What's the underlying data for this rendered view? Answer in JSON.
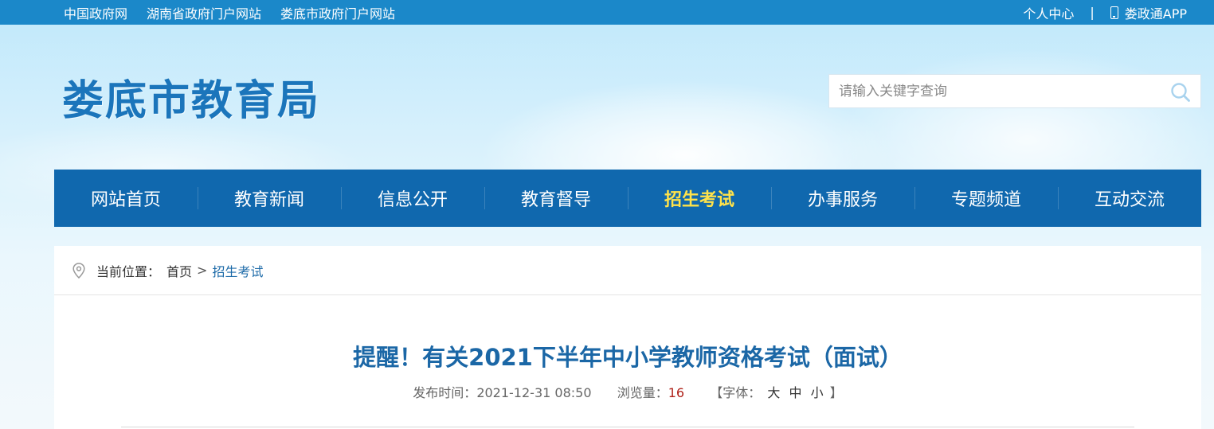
{
  "topbar": {
    "links": [
      "中国政府网",
      "湖南省政府门户网站",
      "娄底市政府门户网站"
    ],
    "personal_center": "个人中心",
    "separator": "|",
    "app": "娄政通APP"
  },
  "site": {
    "logo_text": "娄底市教育局"
  },
  "search": {
    "placeholder": "请输入关键字查询"
  },
  "nav": {
    "items": [
      "网站首页",
      "教育新闻",
      "信息公开",
      "教育督导",
      "招生考试",
      "办事服务",
      "专题频道",
      "互动交流"
    ],
    "active_index": 4
  },
  "breadcrumb": {
    "label": "当前位置：",
    "home": "首页",
    "separator": ">",
    "current": "招生考试"
  },
  "article": {
    "title": "提醒！有关2021下半年中小学教师资格考试（面试）",
    "publish_label": "发布时间：",
    "publish_time": "2021-12-31 08:50",
    "views_label": "浏览量：",
    "views": "16",
    "font_open": "【字体：",
    "font_large": "大",
    "font_medium": "中",
    "font_small": "小",
    "font_close": "】"
  },
  "colors": {
    "topbar": "#1b88c9",
    "nav": "#1068ae",
    "nav_active": "#ffe24a",
    "title": "#1b67a6",
    "views": "#b0241c"
  }
}
